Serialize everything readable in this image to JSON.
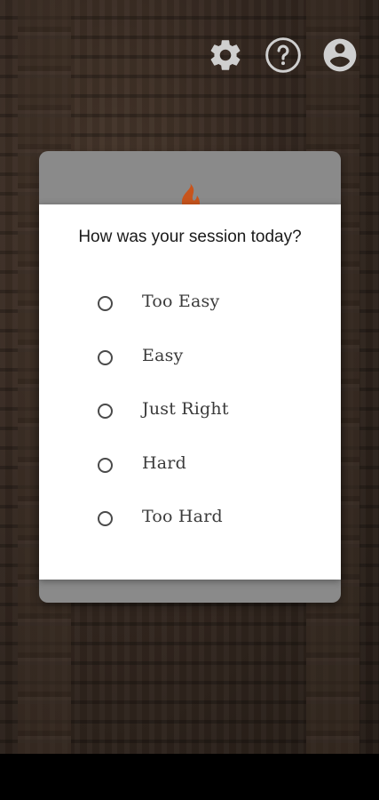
{
  "header": {
    "settings_icon": "gear-icon",
    "help_icon": "help-circle-icon",
    "account_icon": "account-circle-icon"
  },
  "dialog": {
    "title": "How was your session today?",
    "options": [
      {
        "label": "Too Easy",
        "selected": false
      },
      {
        "label": "Easy",
        "selected": false
      },
      {
        "label": "Just Right",
        "selected": false
      },
      {
        "label": "Hard",
        "selected": false
      },
      {
        "label": "Too Hard",
        "selected": false
      }
    ]
  },
  "colors": {
    "icon": "#cfcfcf",
    "dialog_bg": "#ffffff",
    "card_back": "#8a8a8a",
    "flame": "#c8541c",
    "radio_border": "#4a4a4a",
    "text_dark": "#1a1a1a"
  }
}
